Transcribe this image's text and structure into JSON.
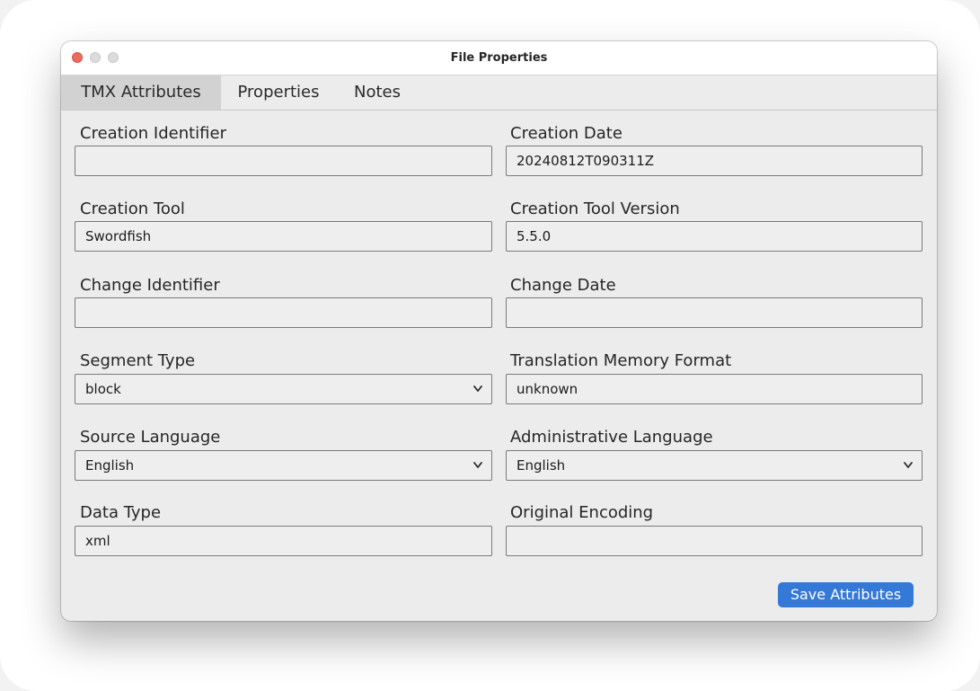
{
  "window": {
    "title": "File Properties"
  },
  "tabs": [
    {
      "label": "TMX Attributes",
      "active": true
    },
    {
      "label": "Properties",
      "active": false
    },
    {
      "label": "Notes",
      "active": false
    }
  ],
  "fields": {
    "creation_identifier": {
      "label": "Creation Identifier",
      "value": ""
    },
    "creation_date": {
      "label": "Creation Date",
      "value": "20240812T090311Z"
    },
    "creation_tool": {
      "label": "Creation Tool",
      "value": "Swordfish"
    },
    "creation_tool_version": {
      "label": "Creation Tool Version",
      "value": "5.5.0"
    },
    "change_identifier": {
      "label": "Change Identifier",
      "value": ""
    },
    "change_date": {
      "label": "Change Date",
      "value": ""
    },
    "segment_type": {
      "label": "Segment Type",
      "value": "block"
    },
    "translation_memory_format": {
      "label": "Translation Memory Format",
      "value": "unknown"
    },
    "source_language": {
      "label": "Source Language",
      "value": "English"
    },
    "administrative_language": {
      "label": "Administrative Language",
      "value": "English"
    },
    "data_type": {
      "label": "Data Type",
      "value": "xml"
    },
    "original_encoding": {
      "label": "Original Encoding",
      "value": ""
    }
  },
  "actions": {
    "save_label": "Save Attributes"
  },
  "colors": {
    "accent": "#3478d8",
    "close_button": "#ed6a5e"
  },
  "icons": {
    "select_chevron": "chevron-down-icon"
  }
}
